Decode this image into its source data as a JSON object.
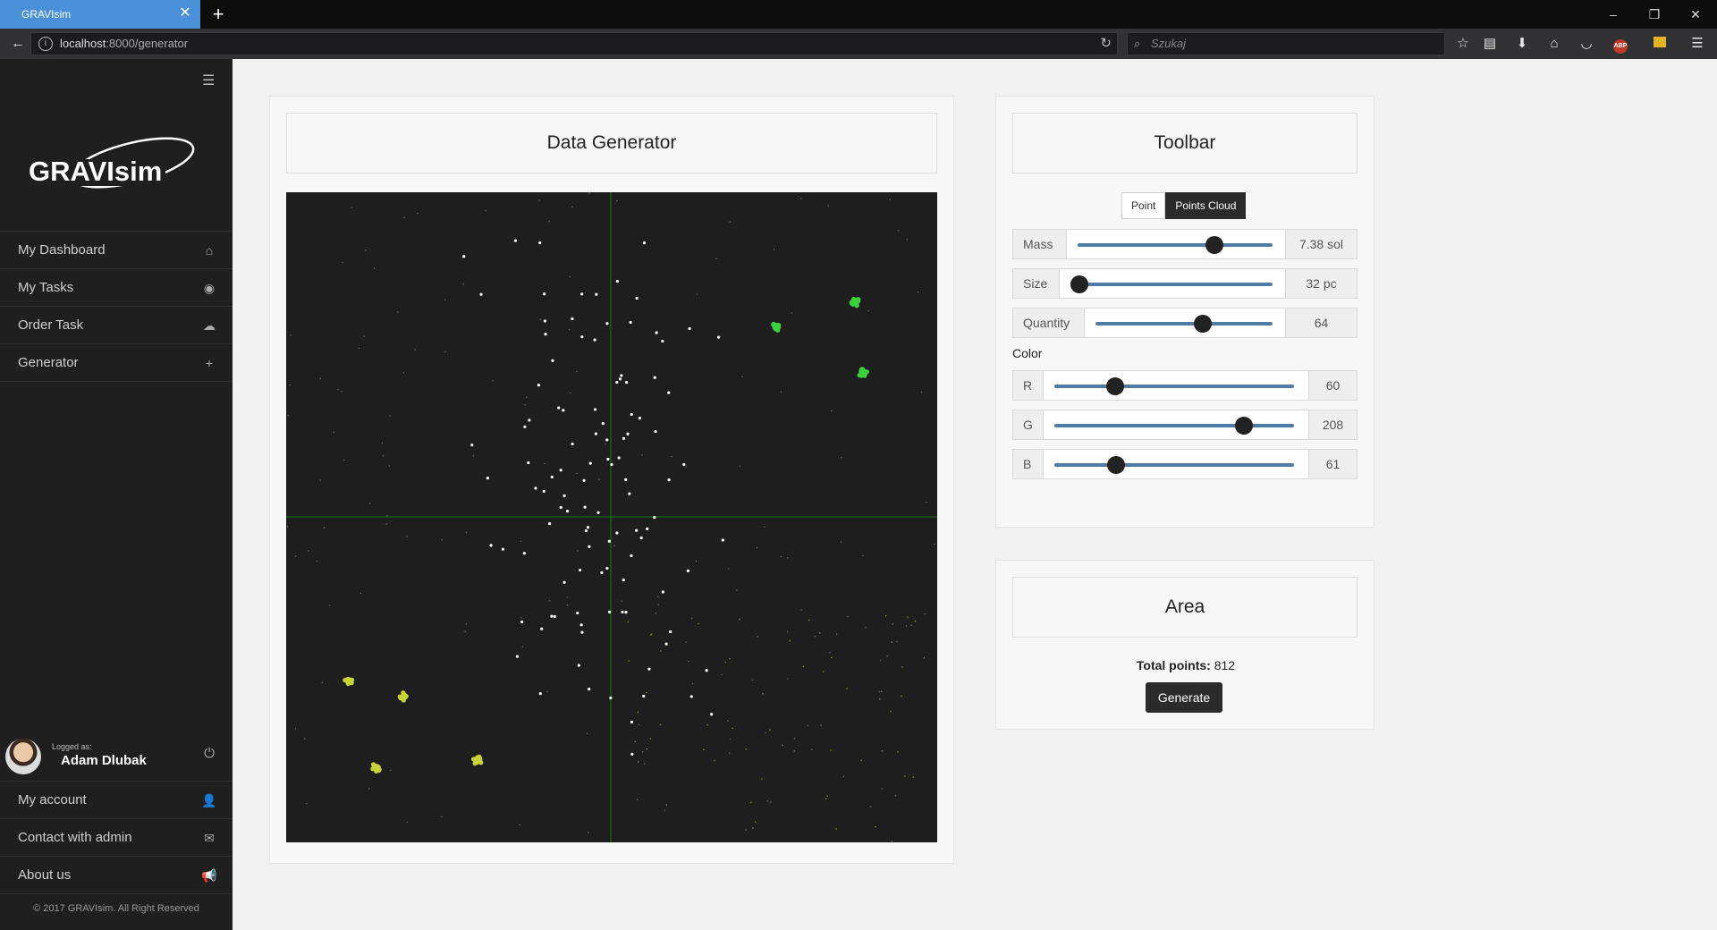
{
  "browser": {
    "tab_title": "GRAVIsim",
    "url_host": "localhost",
    "url_rest": ":8000/generator",
    "search_placeholder": "Szukaj"
  },
  "sidebar": {
    "brand": "GRAVIsim",
    "menu": [
      {
        "label": "My Dashboard",
        "icon": "home-icon"
      },
      {
        "label": "My Tasks",
        "icon": "eye-icon"
      },
      {
        "label": "Order Task",
        "icon": "cloud-upload-icon"
      },
      {
        "label": "Generator",
        "icon": "plus-icon"
      }
    ],
    "user": {
      "logged_label": "Logged as:",
      "name": "Adam Dlubak"
    },
    "bottom_menu": [
      {
        "label": "My account",
        "icon": "user-icon"
      },
      {
        "label": "Contact with admin",
        "icon": "envelope-icon"
      },
      {
        "label": "About us",
        "icon": "megaphone-icon"
      }
    ],
    "copyright": "© 2017 GRAVIsim. All Right Reserved"
  },
  "generator": {
    "title": "Data Generator",
    "cluster_colors": {
      "green": "#3cd03d",
      "lime": "#c6d43a"
    }
  },
  "toolbar": {
    "title": "Toolbar",
    "modes": [
      "Point",
      "Points Cloud"
    ],
    "active_mode": "Points Cloud",
    "mass": {
      "label": "Mass",
      "value": "7.38 sol",
      "level": 0.72
    },
    "size": {
      "label": "Size",
      "value": "32 pc",
      "level": 0.0
    },
    "quantity": {
      "label": "Quantity",
      "value": "64",
      "level": 0.62
    },
    "color_label": "Color",
    "r": {
      "label": "R",
      "value": "60",
      "level": 0.235
    },
    "g": {
      "label": "G",
      "value": "208",
      "level": 0.815
    },
    "b": {
      "label": "B",
      "value": "61",
      "level": 0.239
    }
  },
  "area": {
    "title": "Area",
    "total_label": "Total points:",
    "total_value": "812",
    "generate_label": "Generate"
  }
}
